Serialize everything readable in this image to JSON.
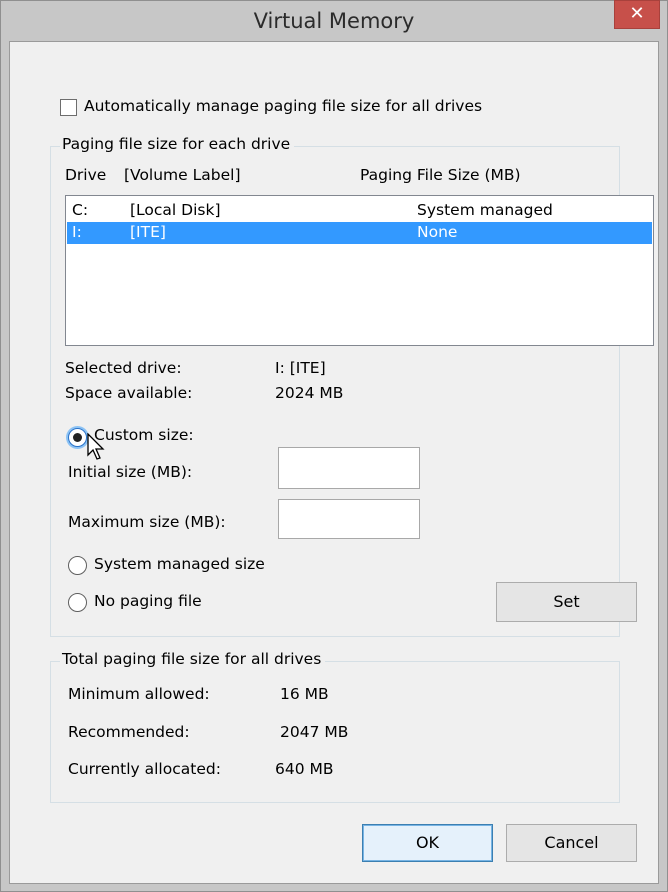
{
  "window": {
    "title": "Virtual Memory",
    "close_glyph": "✕"
  },
  "auto_manage": {
    "label": "Automatically manage paging file size for all drives",
    "checked": false
  },
  "paging_group": {
    "legend": "Paging file size for each drive",
    "col_drive": "Drive",
    "col_volume": "[Volume Label]",
    "col_size": "Paging File Size (MB)",
    "drives": [
      {
        "drive": "C:",
        "label": "[Local Disk]",
        "size": "System managed",
        "selected": false
      },
      {
        "drive": "I:",
        "label": "[ITE]",
        "size": "None",
        "selected": true
      }
    ],
    "selected_drive_label": "Selected drive:",
    "selected_drive_value": "I:  [ITE]",
    "space_available_label": "Space available:",
    "space_available_value": "2024 MB",
    "custom_size_label": "Custom size:",
    "initial_size_label": "Initial size (MB):",
    "initial_size_value": "",
    "maximum_size_label": "Maximum size (MB):",
    "maximum_size_value": "",
    "system_managed_label": "System managed size",
    "no_paging_label": "No paging file",
    "selected_option": "custom",
    "set_button": "Set"
  },
  "total_group": {
    "legend": "Total paging file size for all drives",
    "minimum_label": "Minimum allowed:",
    "minimum_value": "16 MB",
    "recommended_label": "Recommended:",
    "recommended_value": "2047 MB",
    "allocated_label": "Currently allocated:",
    "allocated_value": "640 MB"
  },
  "buttons": {
    "ok": "OK",
    "cancel": "Cancel"
  },
  "colors": {
    "selection": "#3399ff",
    "close_button": "#c7504a",
    "frame": "#c7c7c7",
    "dialog_bg": "#f0f0f0"
  }
}
